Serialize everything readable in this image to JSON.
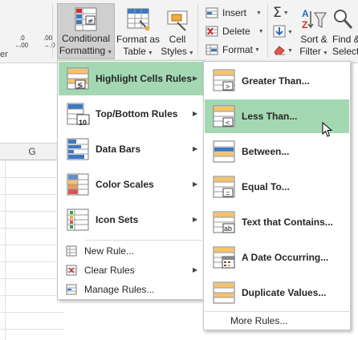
{
  "ribbon": {
    "decimal_increase": {
      "top": ".0",
      "bottom": ".00"
    },
    "decimal_decrease": {
      "top": ".00",
      "bottom": "→.0"
    },
    "group_label_left": "er",
    "conditional_formatting": {
      "line1": "Conditional",
      "line2": "Formatting"
    },
    "format_as_table": {
      "line1": "Format as",
      "line2": "Table"
    },
    "cell_styles": {
      "line1": "Cell",
      "line2": "Styles"
    },
    "insert": "Insert",
    "delete": "Delete",
    "format": "Format",
    "sort_filter": {
      "line1": "Sort &",
      "line2": "Filter"
    },
    "find_select": {
      "line1": "Find &",
      "line2": "Select"
    }
  },
  "sheet": {
    "column_g": "G"
  },
  "cf_menu": {
    "items": [
      {
        "label": "Highlight Cells Rules",
        "has_submenu": true,
        "highlighted": true
      },
      {
        "label": "Top/Bottom Rules",
        "has_submenu": true,
        "icon_text": "10"
      },
      {
        "label": "Data Bars",
        "has_submenu": true
      },
      {
        "label": "Color Scales",
        "has_submenu": true
      },
      {
        "label": "Icon Sets",
        "has_submenu": true
      }
    ],
    "actions": [
      {
        "label": "New Rule..."
      },
      {
        "label": "Clear Rules",
        "has_submenu": true
      },
      {
        "label": "Manage Rules..."
      }
    ]
  },
  "highlight_submenu": {
    "items": [
      {
        "label": "Greater Than...",
        "icon_text": ">"
      },
      {
        "label": "Less Than...",
        "icon_text": "<",
        "highlighted": true
      },
      {
        "label": "Between..."
      },
      {
        "label": "Equal To...",
        "icon_text": "="
      },
      {
        "label": "Text that Contains...",
        "icon_text": "ab"
      },
      {
        "label": "A Date Occurring..."
      },
      {
        "label": "Duplicate Values..."
      }
    ],
    "more_rules": "More Rules..."
  },
  "colors": {
    "hover_green": "#a4d8b3",
    "ribbon_bg": "#f3f3f3",
    "icon_blue": "#3c78c3",
    "icon_orange": "#f0a946"
  }
}
